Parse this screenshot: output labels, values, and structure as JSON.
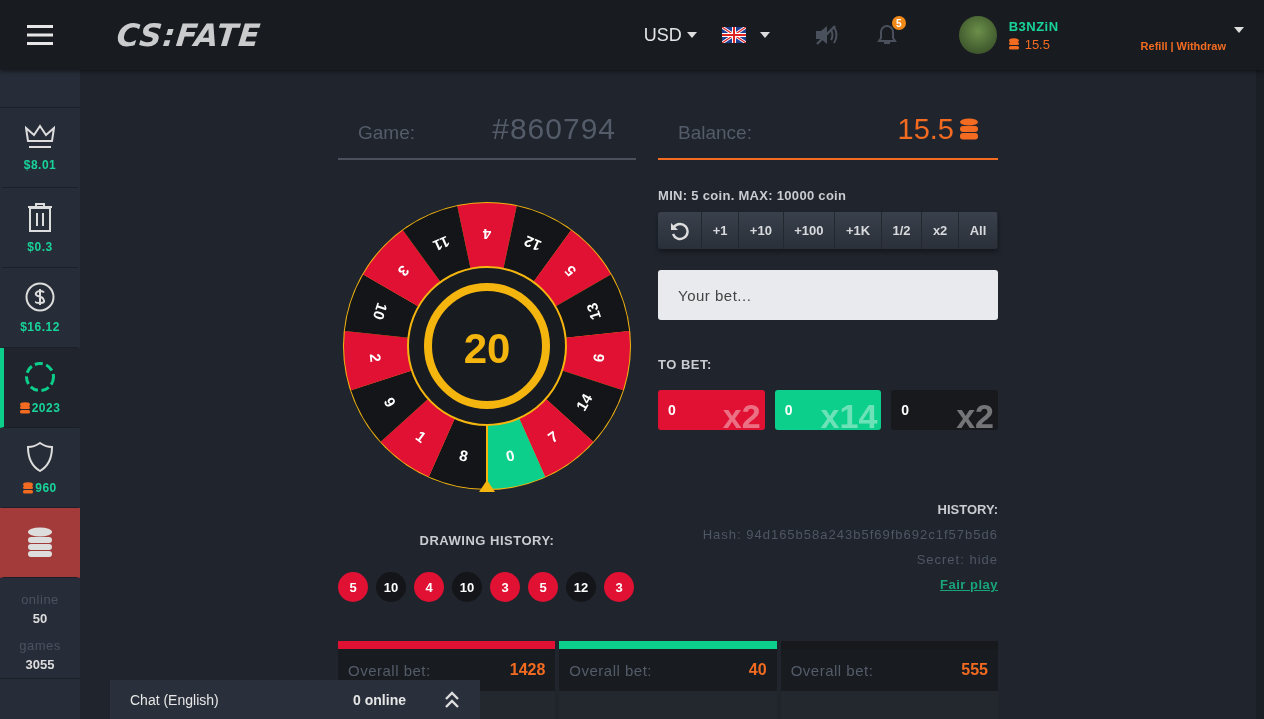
{
  "header": {
    "logo": "CS:FATE",
    "currency": "USD",
    "notifications": "5",
    "user": {
      "name": "B3NZiN",
      "balance": "15.5"
    },
    "links": [
      "Refill",
      "|",
      "Withdraw"
    ]
  },
  "sidebar": {
    "items": [
      {
        "kind": "crown",
        "value": "$8.01",
        "coin": false,
        "selected": false,
        "highlighted": false
      },
      {
        "kind": "trash",
        "value": "$0.3",
        "coin": false,
        "selected": false,
        "highlighted": false
      },
      {
        "kind": "dollar",
        "value": "$16.12",
        "coin": false,
        "selected": false,
        "highlighted": false
      },
      {
        "kind": "ring",
        "value": "2023",
        "coin": true,
        "selected": true,
        "highlighted": false
      },
      {
        "kind": "shield",
        "value": "960",
        "coin": true,
        "selected": false,
        "highlighted": false
      },
      {
        "kind": "coins",
        "selected": false,
        "highlighted": true
      }
    ],
    "stats": [
      {
        "label": "online",
        "value": "50"
      },
      {
        "label": "games",
        "value": "3055"
      }
    ]
  },
  "game": {
    "label": "Game:",
    "number": "#860794"
  },
  "balance": {
    "label": "Balance:",
    "value": "15.5"
  },
  "wheel": {
    "timer": "20",
    "segments": [
      {
        "number": "4",
        "color": "#e01133"
      },
      {
        "number": "12",
        "color": "#141519"
      },
      {
        "number": "5",
        "color": "#e01133"
      },
      {
        "number": "13",
        "color": "#141519"
      },
      {
        "number": "6",
        "color": "#e01133"
      },
      {
        "number": "14",
        "color": "#141519"
      },
      {
        "number": "7",
        "color": "#e01133"
      },
      {
        "number": "0",
        "color": "#0ccf8b"
      },
      {
        "number": "8",
        "color": "#141519"
      },
      {
        "number": "1",
        "color": "#e01133"
      },
      {
        "number": "9",
        "color": "#141519"
      },
      {
        "number": "2",
        "color": "#e01133"
      },
      {
        "number": "10",
        "color": "#141519"
      },
      {
        "number": "3",
        "color": "#e01133"
      },
      {
        "number": "11",
        "color": "#141519"
      }
    ]
  },
  "drawing_history": {
    "title": "DRAWING HISTORY:",
    "items": [
      {
        "number": "5",
        "color": "#e01133"
      },
      {
        "number": "10",
        "color": "#141519"
      },
      {
        "number": "4",
        "color": "#e01133"
      },
      {
        "number": "10",
        "color": "#141519"
      },
      {
        "number": "3",
        "color": "#e01133"
      },
      {
        "number": "5",
        "color": "#e01133"
      },
      {
        "number": "12",
        "color": "#141519"
      },
      {
        "number": "3",
        "color": "#e01133"
      }
    ]
  },
  "limits": "MIN: 5 coin. MAX: 10000 coin",
  "quick_buttons": [
    {
      "kind": "reset"
    },
    {
      "kind": "text",
      "label": "+1"
    },
    {
      "kind": "text",
      "label": "+10"
    },
    {
      "kind": "text",
      "label": "+100"
    },
    {
      "kind": "text",
      "label": "+1K"
    },
    {
      "kind": "text",
      "label": "1/2"
    },
    {
      "kind": "text",
      "label": "x2"
    },
    {
      "kind": "text",
      "label": "All"
    }
  ],
  "bet_input": {
    "placeholder": "Your bet..."
  },
  "to_bet": {
    "title": "TO BET:",
    "buttons": [
      {
        "amount": "0",
        "multiplier": "x2",
        "color": "#e01133"
      },
      {
        "amount": "0",
        "multiplier": "x14",
        "color": "#0ccf8b"
      },
      {
        "amount": "0",
        "multiplier": "x2",
        "color": "#17191d"
      }
    ]
  },
  "round": {
    "title": "HISTORY:",
    "hash": "Hash: 94d165b58a243b5f69fb692c1f57b5d6",
    "secret": "Secret: hide",
    "link": "Fair play"
  },
  "cards": [
    {
      "label": "Overall bet:",
      "total": "1428",
      "color": "#e01133"
    },
    {
      "label": "Overall bet:",
      "total": "40",
      "color": "#0ccf8b"
    },
    {
      "label": "Overall bet:",
      "total": "555",
      "color": "#17191d"
    }
  ],
  "chat": {
    "title": "Chat (English)",
    "online": "0 online"
  }
}
